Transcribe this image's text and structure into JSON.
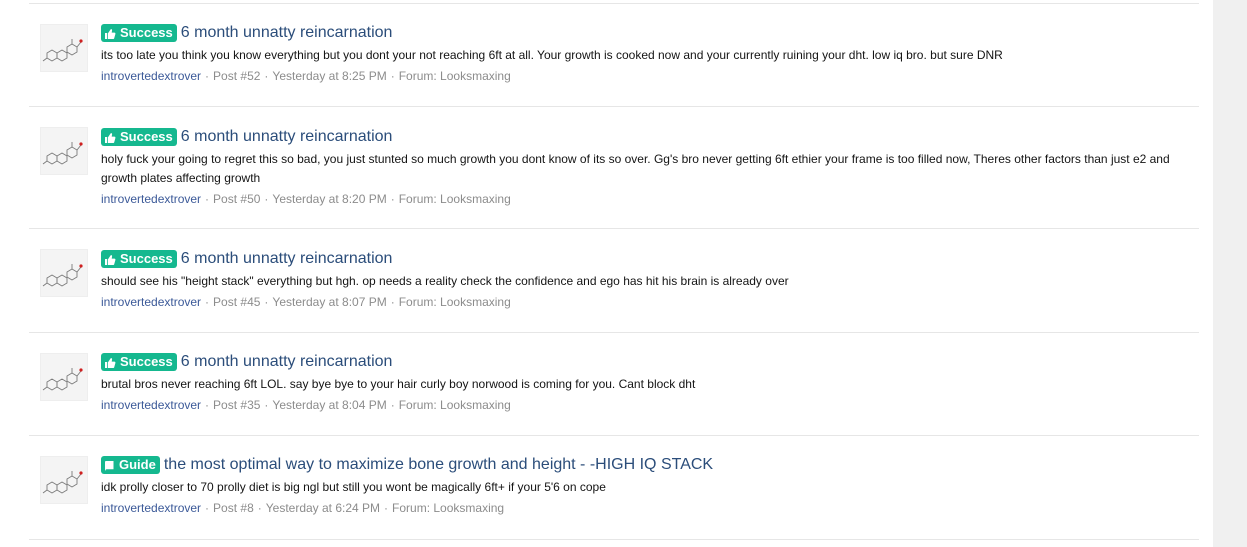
{
  "colors": {
    "label_success": "#15b88f",
    "label_guide": "#15b88f",
    "title_link": "#2b4d7a",
    "user_link": "#3b5998",
    "meta_text": "#8c8c8c"
  },
  "results": [
    {
      "label": "Success",
      "label_icon": "thumbs-up-icon",
      "title": "6 month unnatty reincarnation",
      "snippet": "its too late you think you know everything but you dont your not reaching 6ft at all. Your growth is cooked now and your currently ruining your dht. low iq bro. but sure DNR",
      "user": "introvertedextrover",
      "post": "Post #52",
      "time": "Yesterday at 8:25 PM",
      "forum": "Forum: Looksmaxing"
    },
    {
      "label": "Success",
      "label_icon": "thumbs-up-icon",
      "title": "6 month unnatty reincarnation",
      "snippet": "holy fuck your going to regret this so bad, you just stunted so much growth you dont know of its so over. Gg's bro never getting 6ft ethier your frame is too filled now, Theres other factors than just e2 and growth plates affecting growth",
      "user": "introvertedextrover",
      "post": "Post #50",
      "time": "Yesterday at 8:20 PM",
      "forum": "Forum: Looksmaxing"
    },
    {
      "label": "Success",
      "label_icon": "thumbs-up-icon",
      "title": "6 month unnatty reincarnation",
      "snippet": "should see his \"height stack\" everything but hgh. op needs a reality check the confidence and ego has hit his brain is already over",
      "user": "introvertedextrover",
      "post": "Post #45",
      "time": "Yesterday at 8:07 PM",
      "forum": "Forum: Looksmaxing"
    },
    {
      "label": "Success",
      "label_icon": "thumbs-up-icon",
      "title": "6 month unnatty reincarnation",
      "snippet": "brutal bros never reaching 6ft LOL. say bye bye to your hair curly boy norwood is coming for you. Cant block dht",
      "user": "introvertedextrover",
      "post": "Post #35",
      "time": "Yesterday at 8:04 PM",
      "forum": "Forum: Looksmaxing"
    },
    {
      "label": "Guide",
      "label_icon": "book-icon",
      "title": "the most optimal way to maximize bone growth and height - -HIGH IQ STACK",
      "snippet": "idk prolly closer to 70 prolly diet is big ngl but still you wont be magically 6ft+ if your 5'6 on cope",
      "user": "introvertedextrover",
      "post": "Post #8",
      "time": "Yesterday at 6:24 PM",
      "forum": "Forum: Looksmaxing"
    }
  ]
}
